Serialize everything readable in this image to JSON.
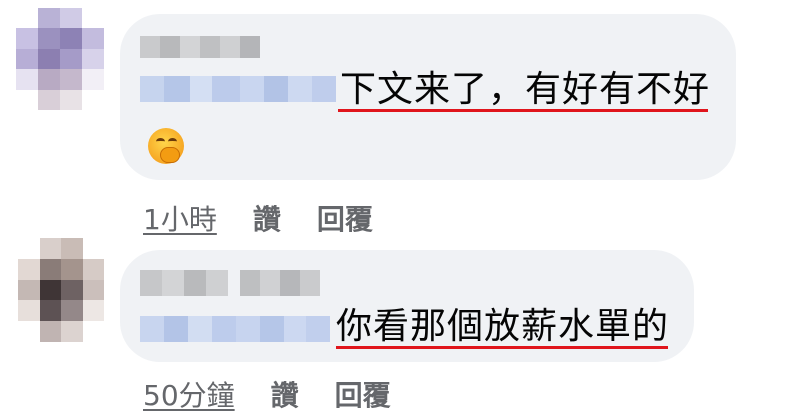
{
  "comments": [
    {
      "text": "下文来了，有好有不好",
      "emoji": "hand-over-mouth-emoji",
      "time": "1小時",
      "like": "讚",
      "reply": "回覆"
    },
    {
      "text": "你看那個放薪水單的",
      "time": "50分鐘",
      "like": "讚",
      "reply": "回覆"
    }
  ],
  "colors": {
    "bubble": "#f0f2f5",
    "underline": "#e0151c",
    "action_text": "#65676b"
  }
}
